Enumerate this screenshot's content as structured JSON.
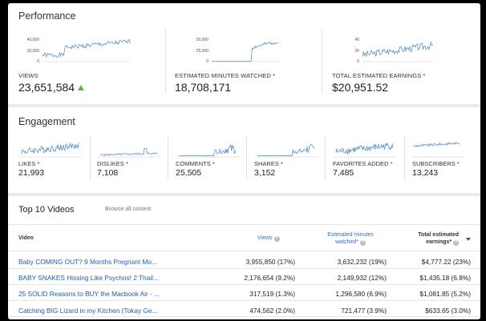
{
  "performance": {
    "title": "Performance",
    "cards": [
      {
        "label": "VIEWS",
        "value": "23,651,584",
        "ticks": [
          "40,000",
          "20,000",
          "0"
        ],
        "trend": "up"
      },
      {
        "label": "ESTIMATED MINUTES WATCHED *",
        "value": "18,708,171",
        "ticks": [
          "50,000",
          "25,000",
          "0"
        ]
      },
      {
        "label": "TOTAL ESTIMATED EARNINGS *",
        "value": "$20,951.52",
        "ticks": [
          "40",
          "20",
          "0"
        ]
      }
    ]
  },
  "engagement": {
    "title": "Engagement",
    "cards": [
      {
        "label": "LIKES *",
        "value": "21,993"
      },
      {
        "label": "DISLIKES *",
        "value": "7,108"
      },
      {
        "label": "COMMENTS *",
        "value": "25,505"
      },
      {
        "label": "SHARES *",
        "value": "3,152"
      },
      {
        "label": "FAVORITES ADDED *",
        "value": "7,485"
      },
      {
        "label": "SUBSCRIBERS *",
        "value": "13,243"
      }
    ]
  },
  "top_videos": {
    "title": "Top 10 Videos",
    "browse_link": "Browse all content",
    "headers": {
      "video": "Video",
      "views": "Views",
      "minutes_line1": "Estimated minutes",
      "minutes_line2": "watched*",
      "earnings_line1": "Total estimated",
      "earnings_line2": "earnings*"
    },
    "rows": [
      {
        "title": "Baby COMING OUT? 9 Months Pregnant Mo...",
        "views": "3,955,850 (17%)",
        "minutes": "3,632,232 (19%)",
        "earnings": "$4,777.22 (23%)"
      },
      {
        "title": "BABY SNAKES Hissing Like Psychos! 2 Thail...",
        "views": "2,176,654 (9.2%)",
        "minutes": "2,149,932 (12%)",
        "earnings": "$1,435.18 (6.8%)"
      },
      {
        "title": "25 SOLID Reasons to BUY the Macbook Air - ...",
        "views": "317,519 (1.3%)",
        "minutes": "1,296,580 (6.9%)",
        "earnings": "$1,081.85 (5.2%)"
      },
      {
        "title": "Catching BIG Lizard in my Kitchen (Tokay Ge...",
        "views": "474,562 (2.0%)",
        "minutes": "721,477 (3.9%)",
        "earnings": "$633.65 (3.0%)"
      }
    ]
  },
  "colors": {
    "spark": "#5b93c8",
    "link": "#1a5fb4",
    "trend_up": "#6aab52"
  },
  "icons": [
    "up-arrow-icon",
    "help-icon",
    "sort-caret-icon"
  ]
}
